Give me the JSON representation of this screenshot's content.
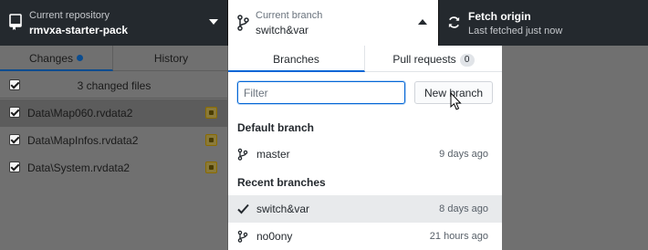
{
  "toolbar": {
    "repository": {
      "title": "Current repository",
      "value": "rmvxa-starter-pack"
    },
    "branch": {
      "title": "Current branch",
      "value": "switch&var"
    },
    "fetch": {
      "title": "Fetch origin",
      "subtitle": "Last fetched just now"
    }
  },
  "sidebar": {
    "tabs": [
      {
        "label": "Changes"
      },
      {
        "label": "History"
      }
    ],
    "summary": "3 changed files",
    "files": [
      {
        "path": "Data\\Map060.rvdata2"
      },
      {
        "path": "Data\\MapInfos.rvdata2"
      },
      {
        "path": "Data\\System.rvdata2"
      }
    ]
  },
  "branch_dropdown": {
    "tabs": [
      {
        "label": "Branches"
      },
      {
        "label": "Pull requests",
        "count": "0"
      }
    ],
    "filter_placeholder": "Filter",
    "new_branch_label": "New branch",
    "default_header": "Default branch",
    "default_branches": [
      {
        "name": "master",
        "time": "9 days ago"
      }
    ],
    "recent_header": "Recent branches",
    "recent_branches": [
      {
        "name": "switch&var",
        "time": "8 days ago",
        "current": true
      },
      {
        "name": "no0ony",
        "time": "21 hours ago",
        "current": false
      }
    ]
  },
  "colors": {
    "toolbar_bg": "#24292e",
    "accent": "#0366d6",
    "modified_badge": "#8a7a3a"
  }
}
